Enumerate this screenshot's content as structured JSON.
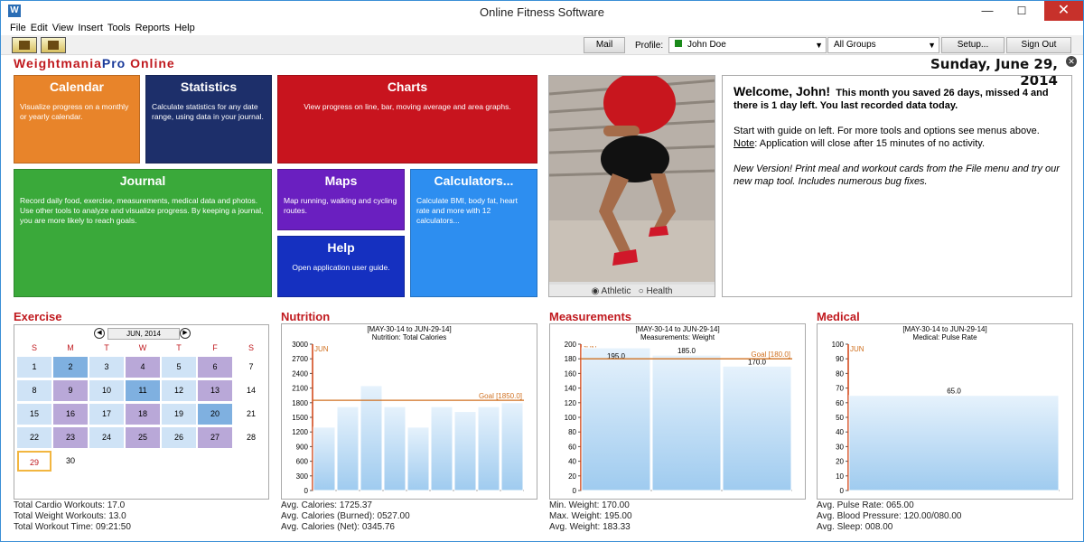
{
  "window": {
    "title": "Online Fitness Software",
    "app_icon": "W",
    "min": "—",
    "max": "☐",
    "close": "✕"
  },
  "menu": [
    "File",
    "Edit",
    "View",
    "Insert",
    "Tools",
    "Reports",
    "Help"
  ],
  "toolbar": {
    "mail": "Mail",
    "profile_label": "Profile:",
    "profile": "John Doe",
    "groups": "All Groups",
    "setup": "Setup...",
    "signout": "Sign Out"
  },
  "brand": {
    "a": "Weightmania",
    "b": "Pro",
    "c": " Online"
  },
  "date": "Sunday, June 29, 2014",
  "tiles": {
    "calendar": {
      "title": "Calendar",
      "desc": "Visualize progress on a monthly or yearly calendar.",
      "color": "#e8842a"
    },
    "statistics": {
      "title": "Statistics",
      "desc": "Calculate statistics for any date range, using data in your journal.",
      "color": "#1d2f6a"
    },
    "charts": {
      "title": "Charts",
      "desc": "View progress on line, bar, moving average and area graphs.",
      "color": "#c8141e"
    },
    "journal": {
      "title": "Journal",
      "desc": "Record daily food, exercise, measurements, medical data and photos.  Use other tools to analyze and visualize progress.  By keeping a journal, you are more likely to reach goals.",
      "color": "#3aa93a"
    },
    "maps": {
      "title": "Maps",
      "desc": "Map running, walking and cycling routes.",
      "color": "#6a1fc0"
    },
    "calculators": {
      "title": "Calculators...",
      "desc": "Calculate BMI, body fat, heart rate and more with 12 calculators...",
      "color": "#2d8ef0"
    },
    "help": {
      "title": "Help",
      "desc": "Open application user guide.",
      "color": "#1530c0"
    }
  },
  "photo": {
    "opt1": "Athletic",
    "opt2": "Health"
  },
  "welcome": {
    "head": "Welcome, John!",
    "msg": "This month you saved 26 days, missed 4 and there is 1 day left.  You last recorded data today.",
    "p1a": "Start with guide on left.  For more tools and options see menus above.  ",
    "note": "Note",
    "p1b": ": Application will close after 15 minutes of no activity.",
    "p2": "New Version! Print meal and workout cards from the File menu and try our new map tool.  Includes numerous bug fixes."
  },
  "exercise": {
    "title": "Exercise",
    "month": "JUN, 2014",
    "dow": [
      "S",
      "M",
      "T",
      "W",
      "T",
      "F",
      "S"
    ],
    "weeks": [
      [
        1,
        2,
        3,
        4,
        5,
        6,
        7
      ],
      [
        8,
        9,
        10,
        11,
        12,
        13,
        14
      ],
      [
        15,
        16,
        17,
        18,
        19,
        20,
        21
      ],
      [
        22,
        23,
        24,
        25,
        26,
        27,
        28
      ],
      [
        29,
        30,
        null,
        null,
        null,
        null,
        null
      ]
    ],
    "stats": [
      "Total Cardio Workouts: 17.0",
      "Total Weight Workouts: 13.0",
      "Total Workout Time: 09:21:50"
    ]
  },
  "nutrition": {
    "title": "Nutrition",
    "range": "[MAY-30-14 to JUN-29-14]",
    "sub": "Nutrition:  Total Calories",
    "stats": [
      "Avg. Calories: 1725.37",
      "Avg. Calories (Burned): 0527.00",
      "Avg. Calories (Net): 0345.76"
    ]
  },
  "measurements": {
    "title": "Measurements",
    "range": "[MAY-30-14 to JUN-29-14]",
    "sub": "Measurements:  Weight",
    "stats": [
      "Min. Weight: 170.00",
      "Max. Weight: 195.00",
      "Avg. Weight: 183.33"
    ]
  },
  "medical": {
    "title": "Medical",
    "range": "[MAY-30-14 to JUN-29-14]",
    "sub": "Medical:  Pulse Rate",
    "stats": [
      "Avg. Pulse Rate: 065.00",
      "Avg. Blood Pressure: 120.00/080.00",
      "Avg. Sleep: 008.00"
    ]
  },
  "chart_data": [
    {
      "type": "bar",
      "name": "nutrition",
      "xlabel": "JUN",
      "ylim": [
        0,
        3000
      ],
      "yticks": [
        0,
        300,
        600,
        900,
        1200,
        1500,
        1800,
        2100,
        2400,
        2700,
        3000
      ],
      "values": [
        1300,
        1720,
        2150,
        1720,
        1300,
        1720,
        1620,
        1720,
        1800
      ],
      "goal": 1850,
      "goal_label": "Goal [1850.0]",
      "bar_labels": []
    },
    {
      "type": "bar",
      "name": "measurements",
      "xlabel": "JUN",
      "ylim": [
        0,
        200
      ],
      "yticks": [
        0,
        20,
        40,
        60,
        80,
        100,
        120,
        140,
        160,
        180,
        200
      ],
      "values": [
        195,
        185,
        170
      ],
      "goal": 180,
      "goal_label": "Goal [180.0]",
      "bar_labels": [
        "195.0",
        "185.0",
        "170.0"
      ]
    },
    {
      "type": "bar",
      "name": "medical",
      "xlabel": "JUN",
      "ylim": [
        0,
        100
      ],
      "yticks": [
        0,
        10,
        20,
        30,
        40,
        50,
        60,
        70,
        80,
        90,
        100
      ],
      "values": [
        65
      ],
      "goal": null,
      "goal_label": "",
      "bar_labels": [
        "65.0"
      ]
    }
  ]
}
